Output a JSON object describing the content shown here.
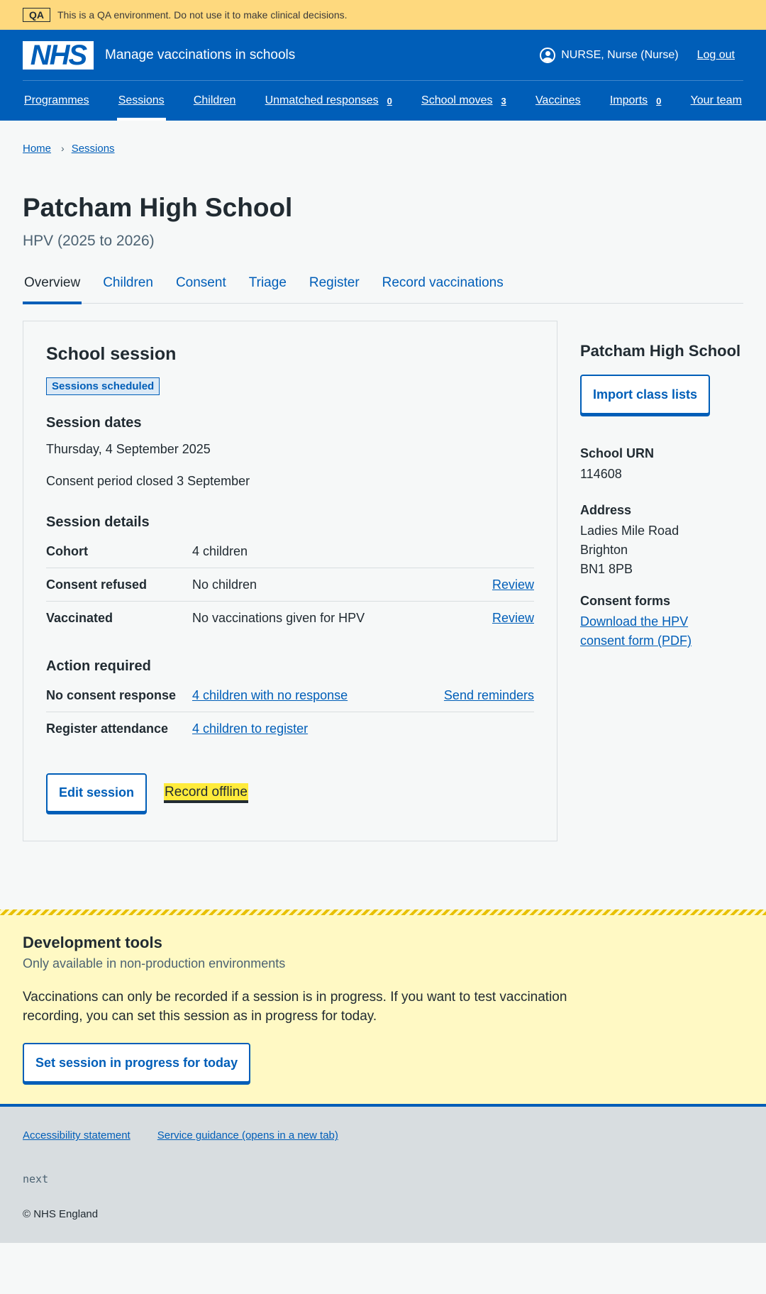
{
  "qa_banner": {
    "tag": "QA",
    "text": "This is a QA environment. Do not use it to make clinical decisions."
  },
  "header": {
    "logo": "NHS",
    "service_name": "Manage vaccinations in schools",
    "user": "NURSE, Nurse (Nurse)",
    "logout": "Log out"
  },
  "nav": [
    {
      "label": "Programmes",
      "count": ""
    },
    {
      "label": "Sessions",
      "count": "",
      "active": true
    },
    {
      "label": "Children",
      "count": ""
    },
    {
      "label": "Unmatched responses",
      "count": "0"
    },
    {
      "label": "School moves",
      "count": "3"
    },
    {
      "label": "Vaccines",
      "count": ""
    },
    {
      "label": "Imports",
      "count": "0"
    },
    {
      "label": "Your team",
      "count": ""
    }
  ],
  "breadcrumb": {
    "home": "Home",
    "sessions": "Sessions"
  },
  "page": {
    "title": "Patcham High School",
    "caption": "HPV (2025 to 2026)"
  },
  "tabs": [
    "Overview",
    "Children",
    "Consent",
    "Triage",
    "Register",
    "Record vaccinations"
  ],
  "card": {
    "title": "School session",
    "status_tag": "Sessions scheduled",
    "dates_heading": "Session dates",
    "date": "Thursday, 4 September 2025",
    "consent_period": "Consent period closed 3 September",
    "details_heading": "Session details",
    "details": [
      {
        "key": "Cohort",
        "value": "4 children",
        "action": ""
      },
      {
        "key": "Consent refused",
        "value": "No children",
        "action": "Review"
      },
      {
        "key": "Vaccinated",
        "value": "No vaccinations given for HPV",
        "action": "Review"
      }
    ],
    "action_heading": "Action required",
    "actions": [
      {
        "key": "No consent response",
        "value": "4 children with no response",
        "action": "Send reminders"
      },
      {
        "key": "Register attendance",
        "value": "4 children to register",
        "action": ""
      }
    ],
    "edit_button": "Edit session",
    "record_offline": "Record offline"
  },
  "sidebar": {
    "title": "Patcham High School",
    "import_button": "Import class lists",
    "urn_label": "School URN",
    "urn": "114608",
    "address_label": "Address",
    "address_line1": "Ladies Mile Road",
    "address_line2": "Brighton",
    "address_line3": "BN1 8PB",
    "consent_label": "Consent forms",
    "consent_link": "Download the HPV consent form (PDF)"
  },
  "dev_tools": {
    "title": "Development tools",
    "subtitle": "Only available in non-production environments",
    "text": "Vaccinations can only be recorded if a session is in progress. If you want to test vaccination recording, you can set this session as in progress for today.",
    "button": "Set session in progress for today"
  },
  "footer": {
    "accessibility": "Accessibility statement",
    "guidance": "Service guidance (opens in a new tab)",
    "version": "next",
    "copyright": "© NHS England"
  }
}
